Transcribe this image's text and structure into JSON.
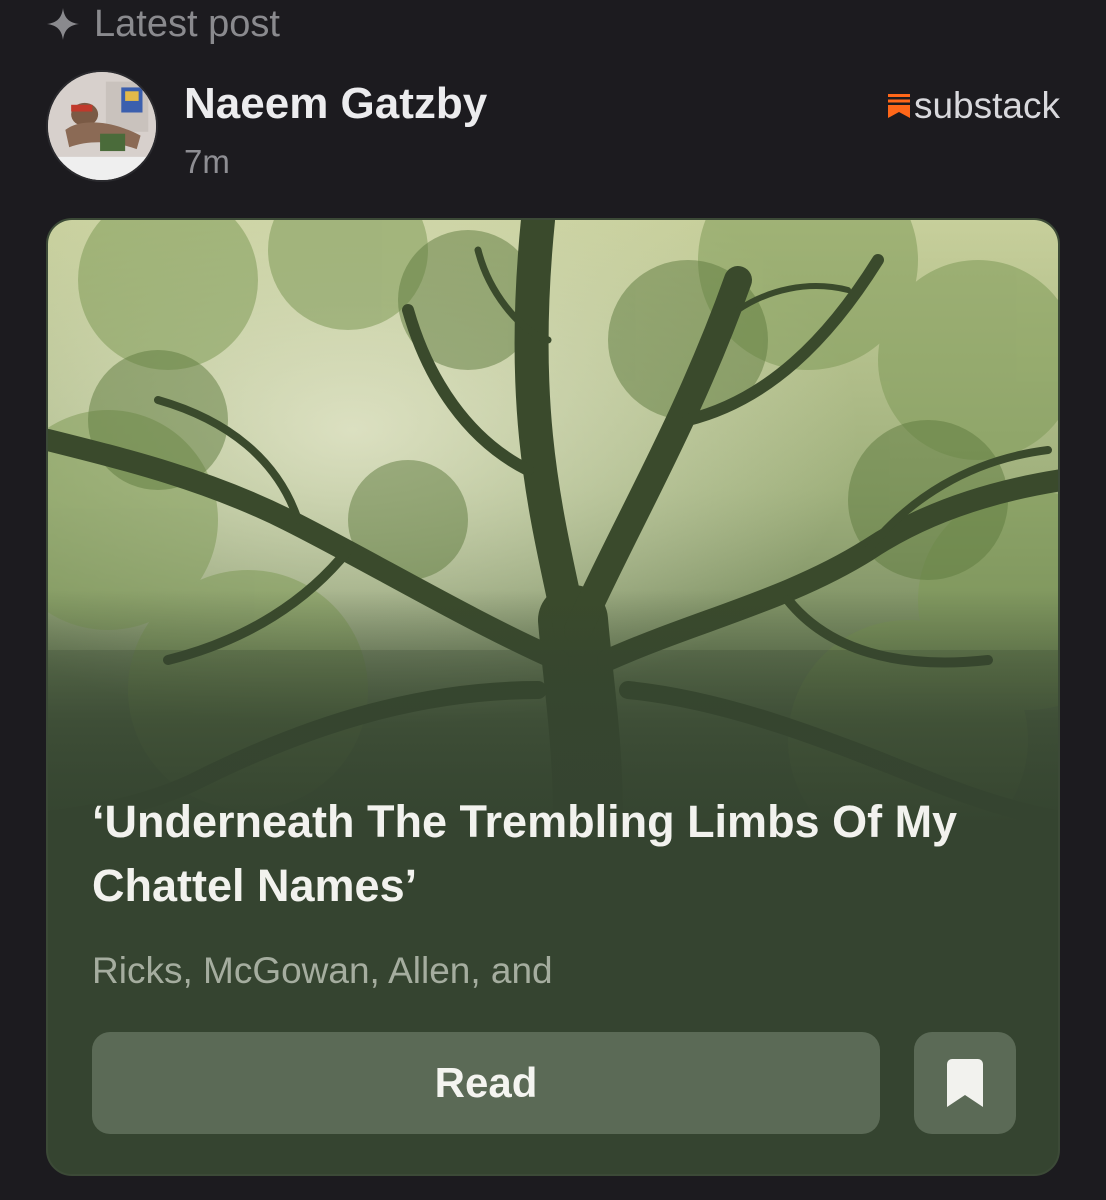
{
  "header": {
    "label": "Latest post",
    "icon": "sparkle-icon"
  },
  "author": {
    "name": "Naeem Gatzby",
    "time": "7m",
    "avatar": "avatar-photo"
  },
  "brand": {
    "name": "substack",
    "icon": "substack-icon",
    "color": "#ff6719"
  },
  "post": {
    "cover_image": "tree-canopy-photo",
    "title": "‘Underneath The Trembling Limbs Of My Chattel Names’",
    "authors": "Ricks, McGowan, Allen, and",
    "read_label": "Read",
    "bookmark_icon": "bookmark-icon",
    "card_color": "#354430"
  }
}
